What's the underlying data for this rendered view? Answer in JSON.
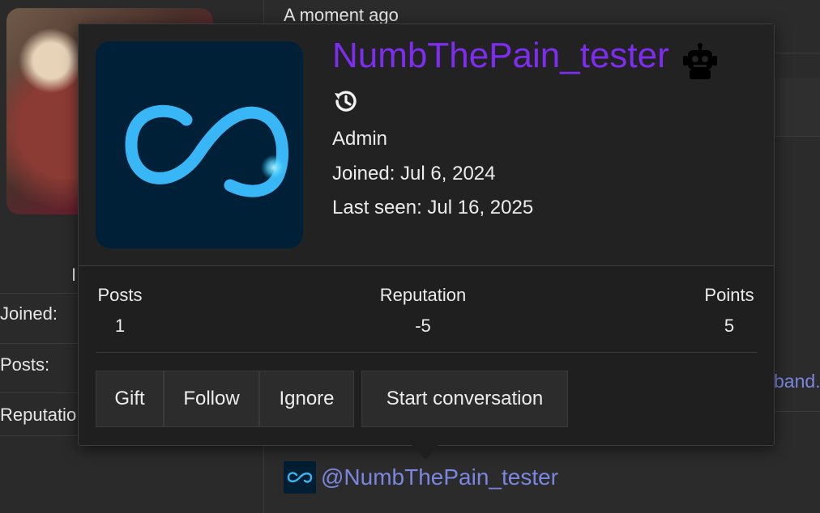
{
  "background": {
    "left_column": {
      "joined_label": "Joined:",
      "posts_label": "Posts:",
      "reputation_label": "Reputatio",
      "clipped_letter": "I"
    },
    "post": {
      "timestamp": "A moment ago",
      "link_fragment": "band.",
      "mention_text": "@NumbThePain_tester"
    }
  },
  "profile_card": {
    "username": "NumbThePain_tester",
    "username_color": "#7d2cf0",
    "bot_icon": "robot-icon",
    "history_icon": "history-icon",
    "role": "Admin",
    "joined": "Joined: Jul 6, 2024",
    "last_seen": "Last seen: Jul 16, 2025",
    "stats": [
      {
        "label": "Posts",
        "value": "1"
      },
      {
        "label": "Reputation",
        "value": "-5"
      },
      {
        "label": "Points",
        "value": "5"
      }
    ],
    "buttons": {
      "gift": "Gift",
      "follow": "Follow",
      "ignore": "Ignore",
      "start_conversation": "Start conversation"
    }
  },
  "colors": {
    "accent": "#7d2cf0",
    "link": "#7b86e0",
    "avatar_bg": "#002038",
    "logo": "#39b6f5"
  }
}
